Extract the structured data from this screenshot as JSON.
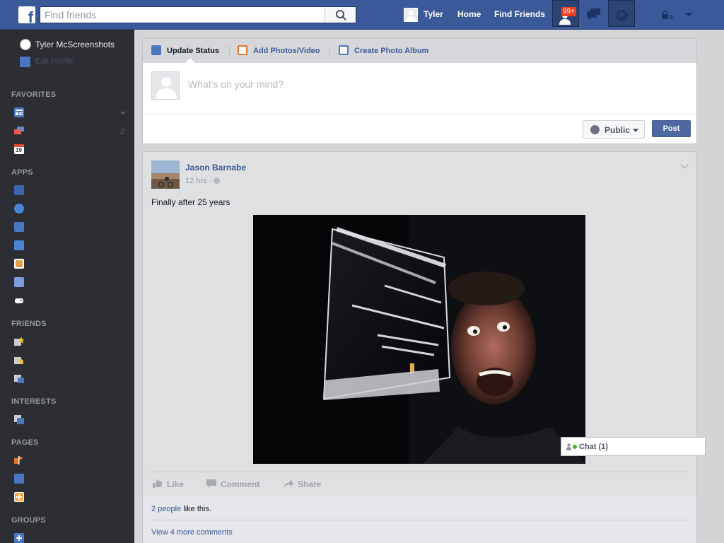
{
  "topbar": {
    "logo_letter": "f",
    "search_placeholder": "Find friends",
    "user_name": "Tyler",
    "home_label": "Home",
    "find_friends_label": "Find Friends",
    "friend_requests_badge": "99+"
  },
  "sidebar": {
    "user_name": "Tyler McScreenshots",
    "edit_profile_label": "Edit Profile",
    "favorites_header": "FAVORITES",
    "messages_count": "2",
    "calendar_day": "19",
    "apps_header": "APPS",
    "friends_header": "FRIENDS",
    "interests_header": "INTERESTS",
    "pages_header": "PAGES",
    "groups_header": "GROUPS"
  },
  "composer": {
    "tabs": [
      "Update Status",
      "Add Photos/Video",
      "Create Photo Album"
    ],
    "placeholder": "What's on your mind?",
    "audience_label": "Public",
    "post_label": "Post"
  },
  "story": {
    "author": "Jason Barnabe",
    "time": "12 hrs",
    "text": "Finally after 25 years",
    "actions": [
      "Like",
      "Comment",
      "Share"
    ],
    "likes_link": "2 people",
    "likes_suffix": " like this.",
    "more_comments": "View 4 more comments"
  },
  "chat": {
    "label": "Chat (1)"
  },
  "colors": {
    "brand_blue": "#3b5998",
    "sidebar_bg": "#2c2e33",
    "badge_red": "#f03d25",
    "online_green": "#42b72a"
  }
}
